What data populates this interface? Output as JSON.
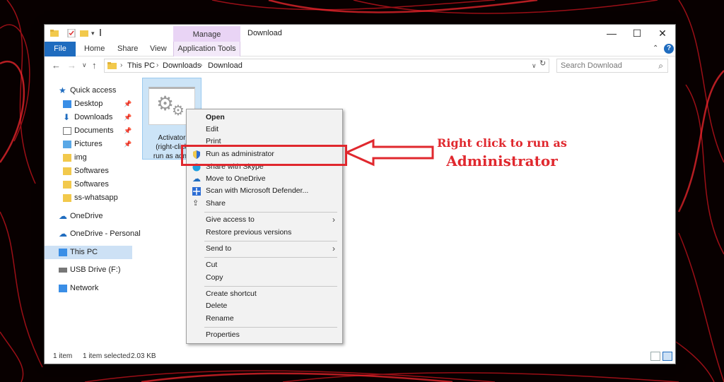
{
  "window": {
    "title": "Download",
    "contextual_group": "Manage",
    "controls": {
      "minimize": "—",
      "maximize": "☐",
      "close": "✕"
    }
  },
  "ribbon": {
    "tabs": [
      "File",
      "Home",
      "Share",
      "View"
    ],
    "contextual_tab": "Application Tools",
    "help": "?"
  },
  "address": {
    "crumbs": [
      "This PC",
      "Downloads",
      "Download"
    ],
    "search_placeholder": "Search Download"
  },
  "navpane": {
    "items": [
      {
        "label": "Quick access"
      },
      {
        "label": "Desktop"
      },
      {
        "label": "Downloads"
      },
      {
        "label": "Documents"
      },
      {
        "label": "Pictures"
      },
      {
        "label": "img"
      },
      {
        "label": "Softwares"
      },
      {
        "label": "Softwares"
      },
      {
        "label": "ss-whatsapp"
      },
      {
        "label": "OneDrive"
      },
      {
        "label": "OneDrive - Personal"
      },
      {
        "label": "This PC"
      },
      {
        "label": "USB Drive (F:)"
      },
      {
        "label": "Network"
      }
    ]
  },
  "file": {
    "line1": "Activator",
    "line2": "(right-click",
    "line3": "run as admi"
  },
  "context_menu": {
    "items": [
      "Open",
      "Edit",
      "Print",
      "Run as administrator",
      "Share with Skype",
      "Move to OneDrive",
      "Scan with Microsoft Defender...",
      "Share",
      "Give access to",
      "Restore previous versions",
      "Send to",
      "Cut",
      "Copy",
      "Create shortcut",
      "Delete",
      "Rename",
      "Properties"
    ]
  },
  "status": {
    "count": "1 item",
    "selected": "1 item selected",
    "size": "2.03 KB"
  },
  "annotation": {
    "line1": "Right click to run as",
    "line2": "Administrator",
    "color": "#e0282e"
  },
  "colors": {
    "accent": "#1f6cbf",
    "selection": "#cce4f7",
    "contextual": "#e9d4f5"
  }
}
